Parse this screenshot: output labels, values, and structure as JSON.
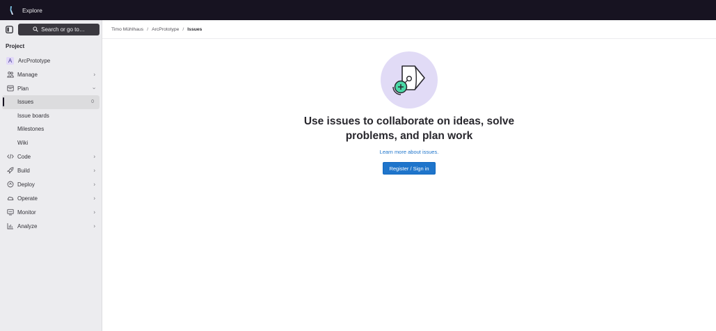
{
  "topbar": {
    "explore_label": "Explore"
  },
  "sidebar": {
    "search_label": "Search or go to…",
    "section_title": "Project",
    "project": {
      "initial": "A",
      "name": "ArcPrototype"
    },
    "items": [
      {
        "label": "Manage",
        "icon": "users-icon"
      },
      {
        "label": "Plan",
        "icon": "plan-icon"
      },
      {
        "label": "Code",
        "icon": "code-icon"
      },
      {
        "label": "Build",
        "icon": "rocket-icon"
      },
      {
        "label": "Deploy",
        "icon": "deploy-icon"
      },
      {
        "label": "Operate",
        "icon": "cloud-icon"
      },
      {
        "label": "Monitor",
        "icon": "monitor-icon"
      },
      {
        "label": "Analyze",
        "icon": "chart-icon"
      }
    ],
    "plan_sub": [
      {
        "label": "Issues",
        "count": "0"
      },
      {
        "label": "Issue boards"
      },
      {
        "label": "Milestones"
      },
      {
        "label": "Wiki"
      }
    ]
  },
  "breadcrumb": [
    "Timo Mühlhaus",
    "ArcPrototype",
    "Issues"
  ],
  "empty_state": {
    "headline": "Use issues to collaborate on ideas, solve problems, and plan work",
    "learn_link": "Learn more about issues.",
    "cta_label": "Register / Sign in"
  },
  "colors": {
    "topbar": "#171321",
    "sidebar": "#ececef",
    "primary": "#1f75cb",
    "illustration_bg": "#e1dbf6",
    "accent_green": "#4ad8a6"
  }
}
